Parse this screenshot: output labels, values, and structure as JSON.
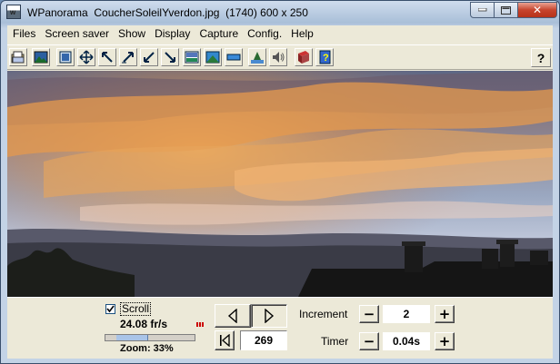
{
  "window": {
    "app_name": "WPanorama",
    "file_name": "CoucherSoleilYverdon.jpg",
    "image_info": "(1740) 600 x 250",
    "app_icon_letter": "w",
    "close_glyph": "✕"
  },
  "menu": [
    "Files",
    "Screen saver",
    "Show",
    "Display",
    "Capture",
    "Config.",
    "Help"
  ],
  "toolbar": {
    "icons": [
      "open-file-icon",
      "picture-icon",
      "fullscreen-icon",
      "resize-arrows-icon",
      "arrow-nw-icon",
      "arrow-ne-icon",
      "arrow-sw-icon",
      "arrow-se-icon",
      "display-gradient-icon",
      "display-wide-icon",
      "display-band-icon",
      "landscape-icon",
      "sound-icon",
      "book-icon",
      "help-book-icon"
    ],
    "help_label": "?"
  },
  "controls": {
    "scroll_label": "Scroll",
    "scroll_checked": true,
    "fps": "24.08 fr/s",
    "zoom": "Zoom: 33%",
    "position": "269",
    "increment_label": "Increment",
    "increment_value": "2",
    "timer_label": "Timer",
    "timer_value": "0.04s",
    "minus": "−",
    "plus": "+"
  },
  "colors": {
    "sky_top": "#5a6784",
    "sunset_orange": "#e8a050",
    "cloud_dark": "#4a4b58",
    "silhouette": "#141414",
    "dialog_bg": "#ece9d8"
  }
}
